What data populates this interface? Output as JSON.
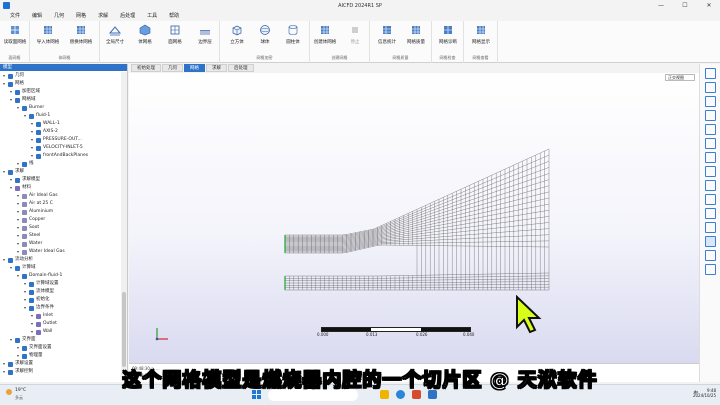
{
  "window": {
    "title": "AICFD 2024R1 SP",
    "controls": [
      "—",
      "☐",
      "✕"
    ]
  },
  "menu": [
    "文件",
    "编辑",
    "几何",
    "网格",
    "求解",
    "后处理",
    "工具",
    "帮助"
  ],
  "ribbon": {
    "buttons": [
      {
        "label": "读取面网格",
        "icon": "read-mesh-icon"
      },
      {
        "label": "导入体网格",
        "icon": "import-mesh-icon"
      },
      {
        "label": "替换体网格",
        "icon": "replace-mesh-icon"
      },
      {
        "label": "全局尺寸",
        "icon": "global-size-icon"
      },
      {
        "label": "体网格",
        "icon": "volume-mesh-icon"
      },
      {
        "label": "面网格",
        "icon": "face-mesh-icon"
      },
      {
        "label": "边界层",
        "icon": "boundary-layer-icon"
      },
      {
        "label": "立方体",
        "icon": "cube-icon"
      },
      {
        "label": "球体",
        "icon": "sphere-icon"
      },
      {
        "label": "圆柱体",
        "icon": "cylinder-icon"
      },
      {
        "label": "创建体网格",
        "icon": "create-mesh-icon"
      },
      {
        "label": "停止",
        "icon": "stop-icon"
      },
      {
        "label": "信息统计",
        "icon": "statistics-icon"
      },
      {
        "label": "网格质量",
        "icon": "quality-icon"
      },
      {
        "label": "网格诊断",
        "icon": "diagnose-icon"
      },
      {
        "label": "网格显示",
        "icon": "display-icon"
      }
    ],
    "groups": [
      "面网格",
      "体网格",
      "网格加密",
      "创建网格",
      "网格质量",
      "网格检查",
      "网格查看"
    ]
  },
  "panel": {
    "title": "模型"
  },
  "tree": [
    {
      "label": "几何",
      "depth": 0,
      "c": "#2e73c8"
    },
    {
      "label": "网格",
      "depth": 0,
      "c": "#2e73c8"
    },
    {
      "label": "加密区域",
      "depth": 1,
      "c": "#2e73c8"
    },
    {
      "label": "网格域",
      "depth": 1,
      "c": "#2e73c8"
    },
    {
      "label": "Burner",
      "depth": 2,
      "c": "#2e73c8"
    },
    {
      "label": "fluid-1",
      "depth": 3,
      "c": "#2e73c8"
    },
    {
      "label": "WALL-1",
      "depth": 4,
      "c": "#2e73c8"
    },
    {
      "label": "AXIS-2",
      "depth": 4,
      "c": "#2e73c8"
    },
    {
      "label": "PRESSURE-OUT...",
      "depth": 4,
      "c": "#2e73c8"
    },
    {
      "label": "VELOCITY-INLET-5",
      "depth": 4,
      "c": "#2e73c8"
    },
    {
      "label": "frontAndBackPlanes",
      "depth": 4,
      "c": "#2e73c8"
    },
    {
      "label": "线",
      "depth": 2,
      "c": "#2e73c8"
    },
    {
      "label": "求解",
      "depth": 0,
      "c": "#2e73c8"
    },
    {
      "label": "求解模型",
      "depth": 1,
      "c": "#2e73c8"
    },
    {
      "label": "材料",
      "depth": 1,
      "c": "#7a6fb8"
    },
    {
      "label": "Air Ideal Gas",
      "depth": 2,
      "c": "#8d8ab8"
    },
    {
      "label": "Air at 25 C",
      "depth": 2,
      "c": "#8d8ab8"
    },
    {
      "label": "Aluminium",
      "depth": 2,
      "c": "#8d8ab8"
    },
    {
      "label": "Copper",
      "depth": 2,
      "c": "#8d8ab8"
    },
    {
      "label": "Soot",
      "depth": 2,
      "c": "#8d8ab8"
    },
    {
      "label": "Steel",
      "depth": 2,
      "c": "#8d8ab8"
    },
    {
      "label": "Water",
      "depth": 2,
      "c": "#8d8ab8"
    },
    {
      "label": "Water Ideal Gas",
      "depth": 2,
      "c": "#8d8ab8"
    },
    {
      "label": "流动分析",
      "depth": 0,
      "c": "#2e73c8"
    },
    {
      "label": "计算域",
      "depth": 1,
      "c": "#2e73c8"
    },
    {
      "label": "Domain-fluid-1",
      "depth": 2,
      "c": "#2e73c8"
    },
    {
      "label": "计算域设置",
      "depth": 3,
      "c": "#2e73c8"
    },
    {
      "label": "流体模型",
      "depth": 3,
      "c": "#2e73c8"
    },
    {
      "label": "初始化",
      "depth": 3,
      "c": "#2e73c8"
    },
    {
      "label": "边界条件",
      "depth": 3,
      "c": "#2e73c8"
    },
    {
      "label": "Inlet",
      "depth": 4,
      "c": "#7a6fb8"
    },
    {
      "label": "Outlet",
      "depth": 4,
      "c": "#7a6fb8"
    },
    {
      "label": "Wall",
      "depth": 4,
      "c": "#7a6fb8"
    },
    {
      "label": "交界面",
      "depth": 1,
      "c": "#2e73c8"
    },
    {
      "label": "交界面设置",
      "depth": 2,
      "c": "#2e73c8"
    },
    {
      "label": "物理量",
      "depth": 2,
      "c": "#2e73c8"
    },
    {
      "label": "求解设置",
      "depth": 0,
      "c": "#2e73c8"
    },
    {
      "label": "求解控制",
      "depth": 0,
      "c": "#2e73c8"
    }
  ],
  "tabs": [
    {
      "label": "初始处理",
      "active": false
    },
    {
      "label": "几何",
      "active": false
    },
    {
      "label": "网格",
      "active": true
    },
    {
      "label": "求解",
      "active": false
    },
    {
      "label": "后处理",
      "active": false
    }
  ],
  "viewport": {
    "view_select": "正交视图",
    "scale_labels": [
      "0.000",
      "0.013",
      "0.026",
      "0.040"
    ]
  },
  "status": {
    "lines": [
      "09:48:30 > ...",
      "09:48:30 > ..."
    ]
  },
  "caption": "这个网格模型是燃烧器内腔的一个切片区 @ 天洑软件",
  "taskbar": {
    "weather": "19°C",
    "weather_sub": "多云",
    "time": "9:48",
    "date": "2024/10/25",
    "lang": "中"
  }
}
